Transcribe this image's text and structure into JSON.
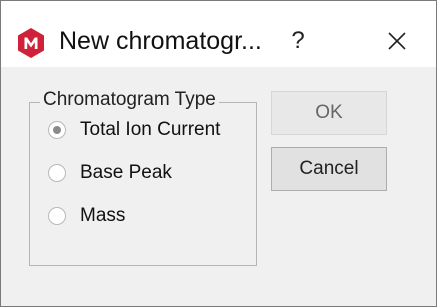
{
  "dialog": {
    "title": "New chromatogr...",
    "help_label": "?",
    "close_icon": "close-icon",
    "app_icon": "app-logo-icon",
    "accent_color": "#d0213a"
  },
  "group": {
    "legend": "Chromatogram Type",
    "options": [
      {
        "label": "Total Ion Current",
        "checked": true
      },
      {
        "label": "Base Peak",
        "checked": false
      },
      {
        "label": "Mass",
        "checked": false
      }
    ]
  },
  "buttons": {
    "ok_label": "OK",
    "cancel_label": "Cancel"
  }
}
